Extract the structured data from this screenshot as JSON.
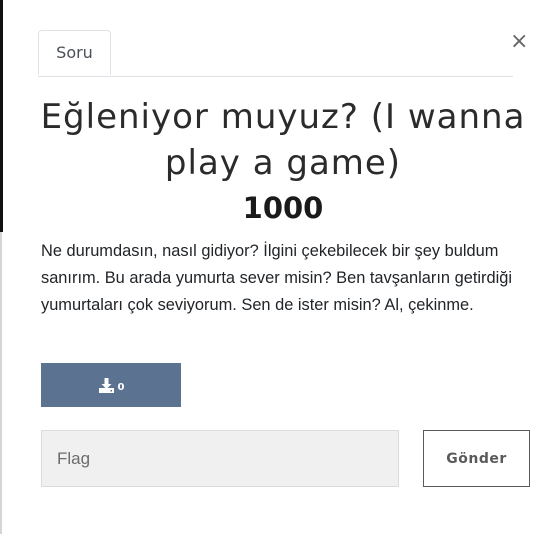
{
  "tabs": [
    {
      "label": "Soru",
      "active": true
    }
  ],
  "close_label": "×",
  "challenge": {
    "title": "Eğleniyor muyuz? (I wanna play a game)",
    "points": "1000",
    "description": "Ne durumdasın, nasıl gidiyor? İlgini çekebilecek bir şey buldum sanırım. Bu arada yumurta sever misin? Ben tavşanların getirdiği yumurtaları çok seviyorum. Sen de ister misin? Al, çekinme."
  },
  "download": {
    "icon": "download-icon",
    "count": "0"
  },
  "flag_form": {
    "input_value": "",
    "placeholder": "Flag",
    "submit_label": "Gönder"
  },
  "colors": {
    "download_button": "#5b7290",
    "flag_input_bg": "#f0f0f0",
    "submit_border": "#5b5b5b"
  }
}
